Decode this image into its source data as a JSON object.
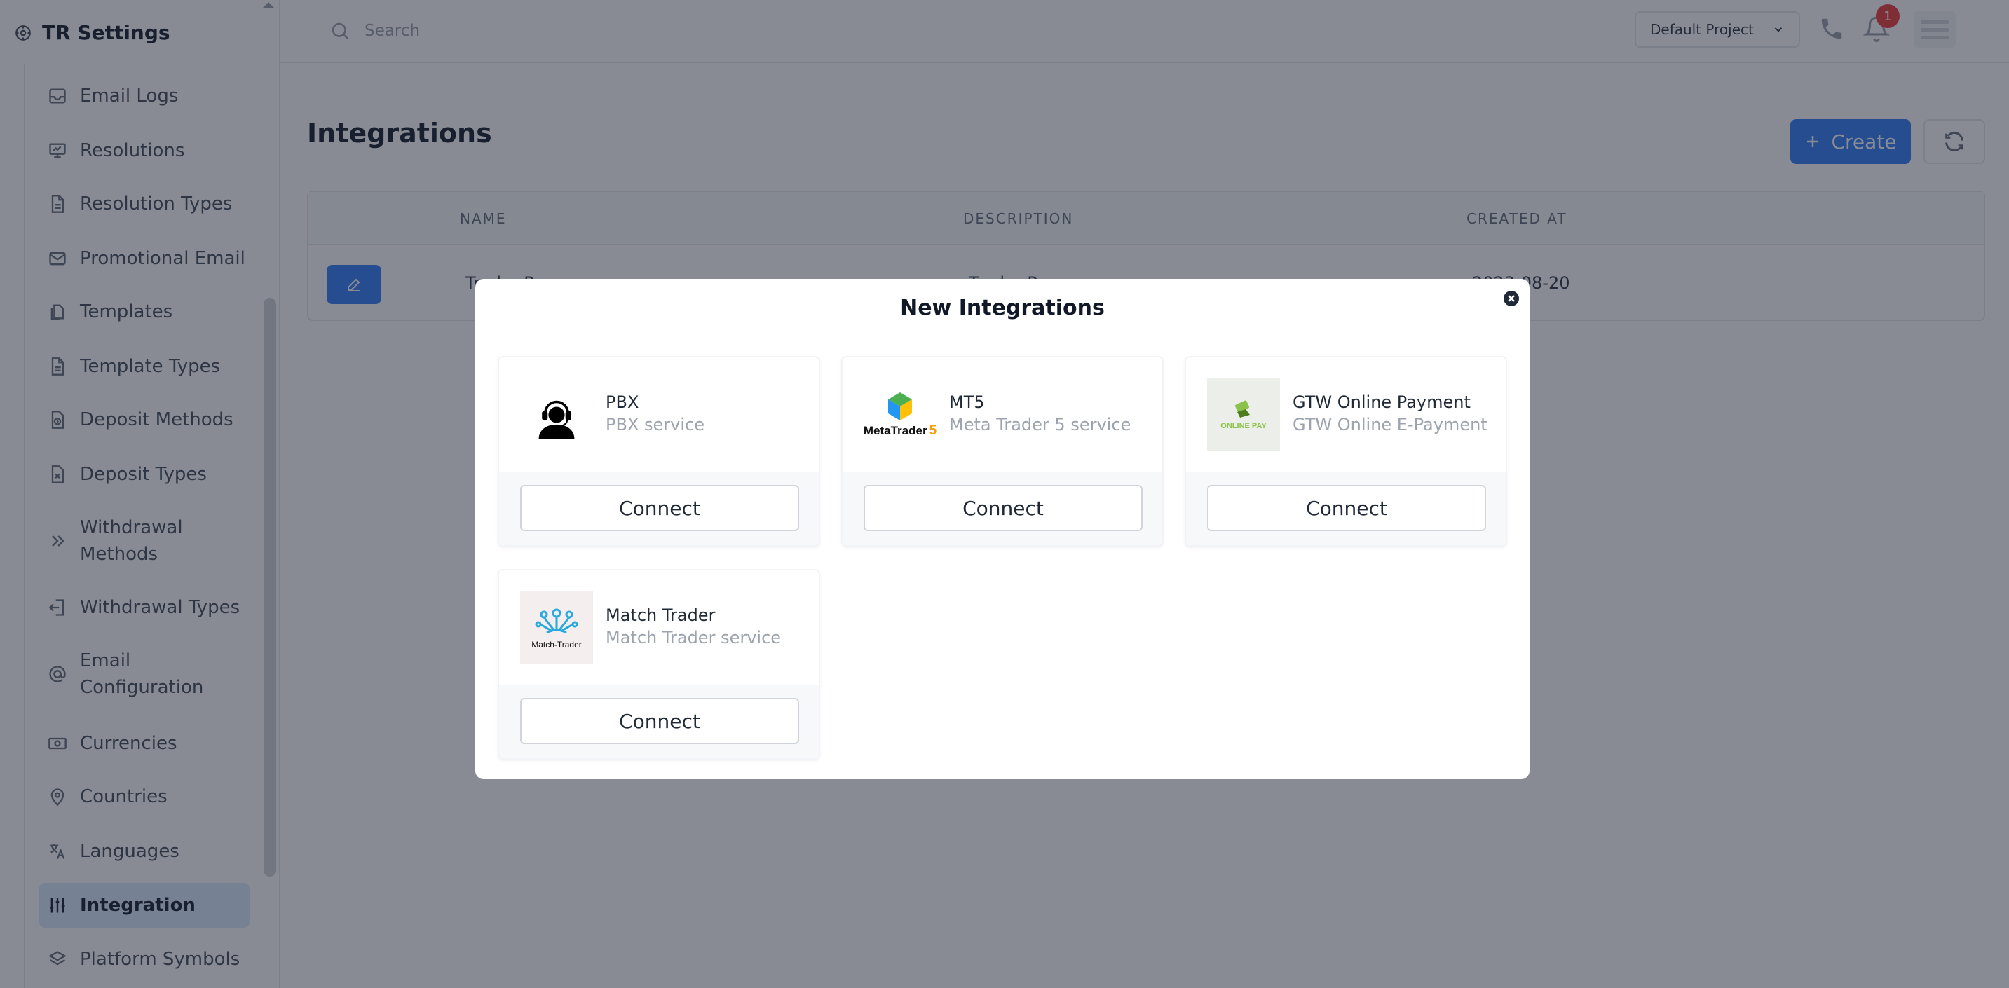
{
  "sidebar": {
    "brand": "TR Settings",
    "items": [
      {
        "label": "Email Logs",
        "icon": "inbox-icon"
      },
      {
        "label": "Resolutions",
        "icon": "presentation-icon"
      },
      {
        "label": "Resolution Types",
        "icon": "document-icon"
      },
      {
        "label": "Promotional Email",
        "icon": "mail-icon"
      },
      {
        "label": "Templates",
        "icon": "documents-icon"
      },
      {
        "label": "Template Types",
        "icon": "document-icon"
      },
      {
        "label": "Deposit Methods",
        "icon": "document-clock-icon"
      },
      {
        "label": "Deposit Types",
        "icon": "document-x-icon"
      },
      {
        "label": "Withdrawal Methods",
        "line1": "Withdrawal",
        "line2": "Methods",
        "icon": "chevrons-right-icon"
      },
      {
        "label": "Withdrawal Types",
        "icon": "logout-icon"
      },
      {
        "label": "Email Configuration",
        "line1": "Email",
        "line2": "Configuration",
        "icon": "at-sign-icon"
      },
      {
        "label": "Currencies",
        "icon": "cash-icon"
      },
      {
        "label": "Countries",
        "icon": "map-pin-icon"
      },
      {
        "label": "Languages",
        "icon": "translate-icon"
      },
      {
        "label": "Integration",
        "icon": "sliders-icon",
        "active": true
      },
      {
        "label": "Platform Symbols",
        "icon": "layers-icon"
      }
    ]
  },
  "topbar": {
    "search_placeholder": "Search",
    "project": "Default Project",
    "notification_count": "1"
  },
  "main": {
    "title": "Integrations",
    "create_label": "Create",
    "table": {
      "headers": [
        "NAME",
        "DESCRIPTION",
        "CREATED AT"
      ],
      "row": {
        "name": "Trader Pay",
        "description": "Trader Pay",
        "created_at": "2023-08-20"
      }
    }
  },
  "modal": {
    "title": "New Integrations",
    "connect_label": "Connect",
    "cards": [
      {
        "name": "PBX",
        "description": "PBX service",
        "logo": "headset-person-icon"
      },
      {
        "name": "MT5",
        "description": "Meta Trader 5 service",
        "logo": "metatrader5-logo",
        "logo_text": "MetaTrader",
        "logo_num": "5"
      },
      {
        "name": "GTW Online Payment",
        "description": "GTW Online E-Payment",
        "logo": "online-pay-logo",
        "logo_text": "ONLINE PAY"
      },
      {
        "name": "Match Trader",
        "description": "Match Trader service",
        "logo": "match-trader-logo",
        "logo_text": "Match-Trader"
      }
    ]
  },
  "colors": {
    "primary": "#3b82f6",
    "active_nav_bg": "#dbeafe",
    "badge": "#ef4444"
  }
}
